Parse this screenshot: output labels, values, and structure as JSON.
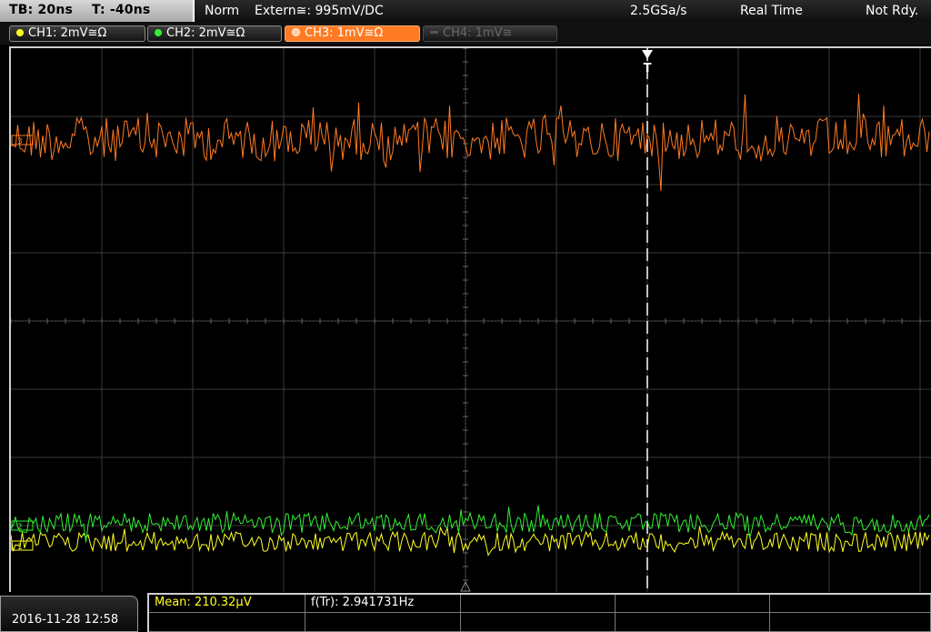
{
  "status_bar": {
    "timebase": "TB: 20ns",
    "trigger_offset": "T: -40ns",
    "trigger_mode": "Norm",
    "trigger_source": "Extern≅: 995mV∕DC",
    "sample_rate": "2.5GSa/s",
    "acquisition": "Real Time",
    "state": "Not Rdy."
  },
  "channels": [
    {
      "label": "CH1: 2mV≅Ω",
      "color": "#ffff22",
      "state": "on"
    },
    {
      "label": "CH2: 2mV≅Ω",
      "color": "#33ee33",
      "state": "on"
    },
    {
      "label": "CH3: 1mV≅Ω",
      "color": "#ff7a22",
      "state": "selected"
    },
    {
      "label": "CH4: 1mV≅",
      "color": "#666666",
      "state": "off"
    }
  ],
  "markers": {
    "trigger": "T",
    "ch1_marker": "1",
    "ch2_marker": "2",
    "ch3_marker": "3"
  },
  "waveforms": {
    "ch3_color": "#ff7a22",
    "ch2_color": "#33ee33",
    "ch1_color": "#ffff22"
  },
  "footer": {
    "datetime": "2016-11-28 12:58",
    "measurements": [
      {
        "label": "Mean: 210.32µV",
        "color": "yellow"
      },
      {
        "label": "f(Tr): 2.941731Hz",
        "color": "white"
      }
    ]
  }
}
